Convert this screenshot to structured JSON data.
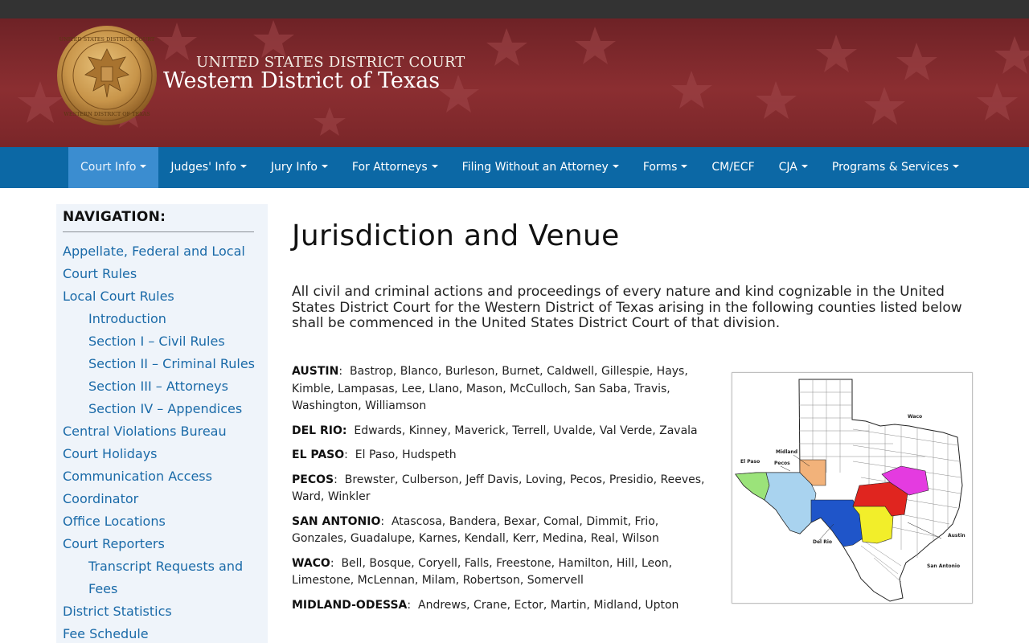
{
  "header": {
    "court_line1": "UNITED STATES DISTRICT COURT",
    "court_line2": "Western District of Texas",
    "seal_text": "UNITED STATES DISTRICT COURT · WESTERN DISTRICT OF TEXAS"
  },
  "nav": {
    "items": [
      {
        "label": "Court Info",
        "dropdown": true,
        "active": true
      },
      {
        "label": "Judges' Info",
        "dropdown": true
      },
      {
        "label": "Jury Info",
        "dropdown": true
      },
      {
        "label": "For Attorneys",
        "dropdown": true
      },
      {
        "label": "Filing Without an Attorney",
        "dropdown": true
      },
      {
        "label": "Forms",
        "dropdown": true
      },
      {
        "label": "CM/ECF",
        "dropdown": false
      },
      {
        "label": "CJA",
        "dropdown": true
      },
      {
        "label": "Programs & Services",
        "dropdown": true
      }
    ]
  },
  "sidebar": {
    "heading": "NAVIGATION:",
    "items": [
      {
        "label": "Appellate, Federal and Local",
        "sub": false
      },
      {
        "label": "Court Rules",
        "sub": false
      },
      {
        "label": "Local Court Rules",
        "sub": false
      },
      {
        "label": "Introduction",
        "sub": true
      },
      {
        "label": "Section I – Civil Rules",
        "sub": true
      },
      {
        "label": "Section II – Criminal Rules",
        "sub": true
      },
      {
        "label": "Section III – Attorneys",
        "sub": true
      },
      {
        "label": "Section IV – Appendices",
        "sub": true
      },
      {
        "label": "Central Violations Bureau",
        "sub": false
      },
      {
        "label": "Court Holidays",
        "sub": false
      },
      {
        "label": "Communication Access",
        "sub": false
      },
      {
        "label": "Coordinator",
        "sub": false
      },
      {
        "label": "Office Locations",
        "sub": false
      },
      {
        "label": "Court Reporters",
        "sub": false
      },
      {
        "label": "Transcript Requests and",
        "sub": true
      },
      {
        "label": "Fees",
        "sub": true
      },
      {
        "label": "District Statistics",
        "sub": false
      },
      {
        "label": "Fee Schedule",
        "sub": false
      }
    ]
  },
  "main": {
    "title": "Jurisdiction and Venue",
    "intro": "All civil and criminal actions and proceedings of every nature and kind cognizable in the United States District Court for the Western District of Texas arising in the following counties listed below shall be commenced in the United States District Court of that division.",
    "divisions": [
      {
        "name": "AUSTIN",
        "counties": "Bastrop, Blanco, Burleson, Burnet, Caldwell, Gillespie, Hays, Kimble, Lampasas, Lee, Llano, Mason, McCulloch, San Saba, Travis, Washington, Williamson"
      },
      {
        "name": "DEL RIO:",
        "counties": "Edwards, Kinney, Maverick, Terrell, Uvalde, Val Verde, Zavala"
      },
      {
        "name": "EL PASO",
        "counties": "El Paso, Hudspeth"
      },
      {
        "name": "PECOS",
        "counties": "Brewster, Culberson, Jeff Davis, Loving, Pecos, Presidio, Reeves, Ward, Winkler"
      },
      {
        "name": "SAN ANTONIO",
        "counties": "Atascosa, Bandera, Bexar, Comal, Dimmit, Frio, Gonzales, Guadalupe, Karnes, Kendall, Kerr, Medina, Real, Wilson"
      },
      {
        "name": "WACO",
        "counties": "Bell, Bosque, Coryell, Falls, Freestone, Hamilton, Hill, Leon, Limestone, McLennan, Milam, Robertson, Somervell"
      },
      {
        "name": "MIDLAND-ODESSA",
        "counties": "Andrews, Crane, Ector, Martin, Midland, Upton"
      }
    ]
  },
  "map": {
    "labels": [
      "El Paso",
      "Pecos",
      "Midland",
      "Waco",
      "Del Rio",
      "Austin",
      "San Antonio"
    ],
    "colors": {
      "el_paso": "#9be37a",
      "pecos": "#a9d3ef",
      "midland": "#f2b27a",
      "del_rio": "#1f55c9",
      "san_antonio": "#f2ee2a",
      "austin": "#e0251f",
      "waco": "#e43be0"
    }
  }
}
